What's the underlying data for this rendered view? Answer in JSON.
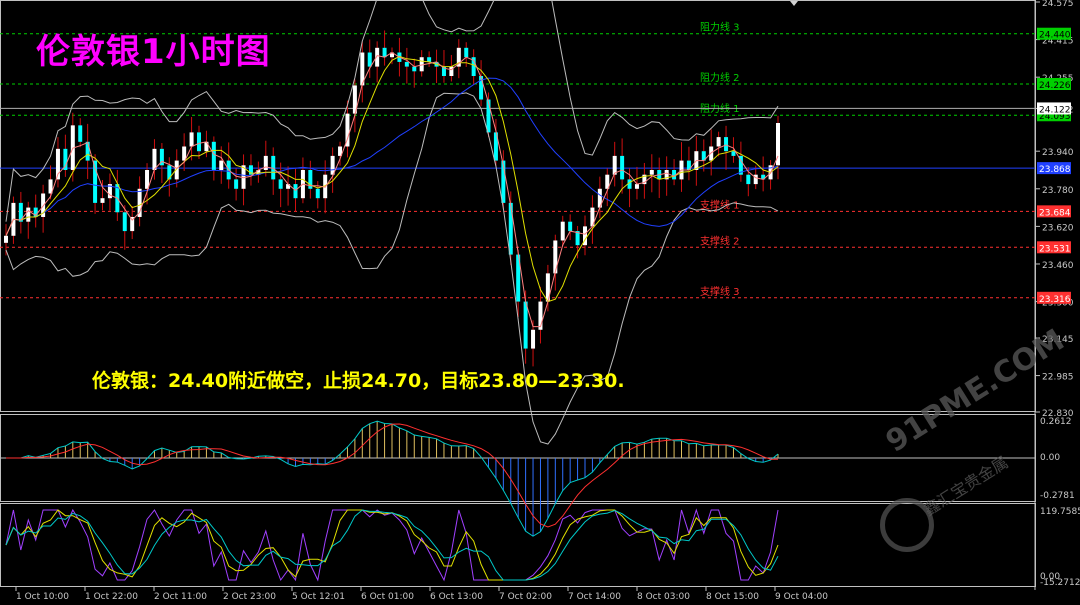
{
  "title": "伦敦银1小时图",
  "note": "伦敦银：24.40附近做空，止损24.70，目标23.80—23.30.",
  "watermark": {
    "brand": "91PME.COM",
    "sub": "鑫汇宝贵金属"
  },
  "chart_data": {
    "type": "candlestick",
    "price_axis": {
      "min": 22.83,
      "max": 24.575,
      "ticks": [
        "24.575",
        "24.415",
        "24.255",
        "24.122",
        "23.940",
        "23.780",
        "23.620",
        "23.460",
        "23.300",
        "23.145",
        "22.985",
        "22.830"
      ]
    },
    "levels": [
      {
        "name": "阻力线 3",
        "value": 24.44,
        "label": "24.440",
        "color": "#00d000"
      },
      {
        "name": "阻力线 2",
        "value": 24.226,
        "label": "24.226",
        "color": "#00d000"
      },
      {
        "name": "阻力线 1",
        "value": 24.093,
        "label": "24.093",
        "color": "#00d000"
      },
      {
        "name": "支撑线 1",
        "value": 23.684,
        "label": "23.684",
        "color": "#ff3030"
      },
      {
        "name": "支撑线 2",
        "value": 23.531,
        "label": "23.531",
        "color": "#ff3030"
      },
      {
        "name": "支撑线 3",
        "value": 23.316,
        "label": "23.316",
        "color": "#ff3030"
      }
    ],
    "current_price": {
      "value": 24.122,
      "label": "24.122"
    },
    "ma_level": {
      "value": 23.868,
      "label": "23.868"
    },
    "time_labels": [
      "1 Oct 10:00",
      "1 Oct 22:00",
      "2 Oct 11:00",
      "2 Oct 23:00",
      "5 Oct 12:01",
      "6 Oct 01:00",
      "6 Oct 13:00",
      "7 Oct 02:00",
      "7 Oct 14:00",
      "8 Oct 03:00",
      "8 Oct 15:00",
      "9 Oct 04:00"
    ],
    "close_path": [
      23.58,
      23.72,
      23.64,
      23.7,
      23.66,
      23.76,
      23.82,
      23.95,
      23.86,
      24.05,
      23.98,
      23.9,
      23.72,
      23.74,
      23.8,
      23.68,
      23.6,
      23.66,
      23.78,
      23.86,
      23.95,
      23.88,
      23.82,
      23.9,
      23.96,
      24.02,
      23.94,
      23.98,
      23.86,
      23.9,
      23.82,
      23.78,
      23.88,
      23.84,
      23.86,
      23.92,
      23.82,
      23.78,
      23.8,
      23.74,
      23.86,
      23.78,
      23.74,
      23.84,
      23.92,
      23.96,
      24.1,
      24.22,
      24.36,
      24.3,
      24.38,
      24.34,
      24.36,
      24.32,
      24.3,
      24.28,
      24.34,
      24.32,
      24.3,
      24.26,
      24.3,
      24.38,
      24.34,
      24.26,
      24.16,
      24.02,
      23.9,
      23.72,
      23.5,
      23.3,
      23.1,
      23.18,
      23.3,
      23.42,
      23.56,
      23.64,
      23.6,
      23.54,
      23.62,
      23.7,
      23.78,
      23.84,
      23.92,
      23.82,
      23.78,
      23.8,
      23.84,
      23.86,
      23.82,
      23.86,
      23.82,
      23.9,
      23.86,
      23.94,
      23.9,
      23.96,
      24.0,
      23.94,
      23.92,
      23.84,
      23.8,
      23.84,
      23.82,
      23.88,
      24.06
    ],
    "macd": {
      "axis_ticks": [
        "0.2612",
        "0.00",
        "-0.2781"
      ]
    },
    "oscillator": {
      "axis_ticks": [
        "119.7585",
        "0.00",
        "-15.2712"
      ]
    }
  }
}
